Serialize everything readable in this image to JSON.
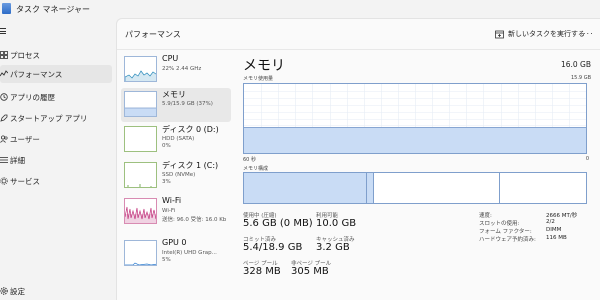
{
  "window": {
    "title": "タスク マネージャー"
  },
  "nav": {
    "items": [
      {
        "label": "プロセス",
        "icon": "processes-icon",
        "active": false
      },
      {
        "label": "パフォーマンス",
        "icon": "performance-icon",
        "active": true
      },
      {
        "label": "アプリの履歴",
        "icon": "app-history-icon",
        "active": false
      },
      {
        "label": "スタートアップ アプリ",
        "icon": "startup-apps-icon",
        "active": false
      },
      {
        "label": "ユーザー",
        "icon": "users-icon",
        "active": false
      },
      {
        "label": "詳細",
        "icon": "details-icon",
        "active": false
      },
      {
        "label": "サービス",
        "icon": "services-icon",
        "active": false
      }
    ],
    "settings_label": "設定"
  },
  "header": {
    "title": "パフォーマンス",
    "run_task_label": "新しいタスクを実行する",
    "more_label": "..."
  },
  "resources": [
    {
      "name": "CPU",
      "line1": "22%  2.44 GHz",
      "line2": "",
      "active": false,
      "kind": "cpu"
    },
    {
      "name": "メモリ",
      "line1": "5.9/15.9 GB (37%)",
      "line2": "",
      "active": true,
      "kind": "memory"
    },
    {
      "name": "ディスク 0 (D:)",
      "line1": "HDD (SATA)",
      "line2": "0%",
      "active": false,
      "kind": "disk"
    },
    {
      "name": "ディスク 1 (C:)",
      "line1": "SSD (NVMe)",
      "line2": "3%",
      "active": false,
      "kind": "disk"
    },
    {
      "name": "Wi-Fi",
      "line1": "Wi-Fi",
      "line2": "送信: 96.0  受信: 16.0 Kb",
      "active": false,
      "kind": "wifi"
    },
    {
      "name": "GPU 0",
      "line1": "Intel(R) UHD Grap...",
      "line2": "5%",
      "active": false,
      "kind": "gpu"
    }
  ],
  "memory": {
    "title": "メモリ",
    "total": "16.0 GB",
    "usage_label": "メモリ使用量",
    "usage_max": "15.9 GB",
    "axis_left": "60 秒",
    "axis_right": "0",
    "composition_label": "メモリ構成",
    "usage_fraction": 0.37,
    "composition": {
      "in_use_fraction": 0.36,
      "modified_fraction": 0.02,
      "standby_fraction": 0.37,
      "free_fraction": 0.25
    },
    "stats": {
      "in_use_label": "使用中 (圧縮)",
      "in_use_value": "5.6 GB (0 MB)",
      "available_label": "利用可能",
      "available_value": "10.0 GB",
      "committed_label": "コミット済み",
      "committed_value": "5.4/18.9 GB",
      "cached_label": "キャッシュ済み",
      "cached_value": "3.2 GB",
      "paged_label": "ページ プール",
      "paged_value": "328 MB",
      "nonpaged_label": "非ページ プール",
      "nonpaged_value": "305 MB"
    },
    "details": [
      {
        "key": "速度:",
        "value": "2666 MT/秒"
      },
      {
        "key": "スロットの使用:",
        "value": "2/2"
      },
      {
        "key": "フォーム ファクター:",
        "value": "DIMM"
      },
      {
        "key": "ハードウェア予約済み:",
        "value": "116 MB"
      }
    ]
  },
  "colors": {
    "memory_fill": "#c9dcf5",
    "memory_stroke": "#7f9fcc",
    "wifi": "#c1307a",
    "cpu": "#2a8bbb",
    "disk": "#5e9d3a",
    "gpu": "#2a7bd0"
  }
}
